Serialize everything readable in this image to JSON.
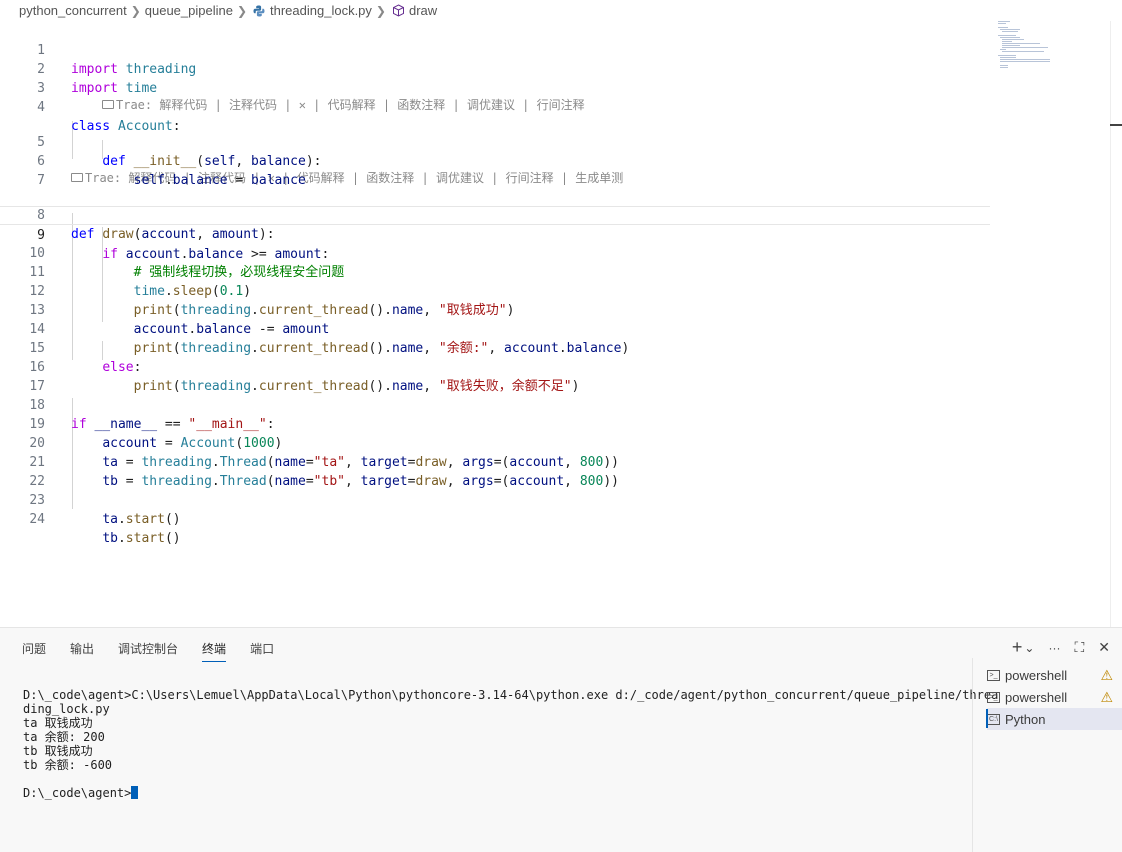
{
  "breadcrumb": {
    "items": [
      "python_concurrent",
      "queue_pipeline",
      "threading_lock.py",
      "draw"
    ]
  },
  "codelens": {
    "class_lens": "Trae: 解释代码 | 注释代码 | ✕ | 代码解释 | 函数注释 | 调优建议 | 行间注释",
    "func_lens": "Trae: 解释代码 | 注释代码 | ✕ | 代码解释 | 函数注释 | 调优建议 | 行间注释 | 生成单测"
  },
  "code": {
    "line_numbers": [
      "1",
      "2",
      "3",
      "4",
      "5",
      "6",
      "7",
      "8",
      "9",
      "10",
      "11",
      "12",
      "13",
      "14",
      "15",
      "16",
      "17",
      "18",
      "19",
      "20",
      "21",
      "22",
      "23",
      "24"
    ],
    "active_line": "9",
    "lines": [
      "import threading",
      "import time",
      "",
      "class Account:",
      "    def __init__(self, balance):",
      "        self.balance = balance",
      "",
      "def draw(account, amount):",
      "    if account.balance >= amount:",
      "        # 强制线程切换，必现线程安全问题",
      "        time.sleep(0.1)",
      "        print(threading.current_thread().name, \"取钱成功\")",
      "        account.balance -= amount",
      "        print(threading.current_thread().name, \"余额:\", account.balance)",
      "    else:",
      "        print(threading.current_thread().name, \"取钱失败，余额不足\")",
      "",
      "if __name__ == \"__main__\":",
      "    account = Account(1000)",
      "    ta = threading.Thread(name=\"ta\", target=draw, args=(account, 800))",
      "    tb = threading.Thread(name=\"tb\", target=draw, args=(account, 800))",
      "",
      "    ta.start()",
      "    tb.start()"
    ]
  },
  "panel": {
    "tabs": [
      "问题",
      "输出",
      "调试控制台",
      "终端",
      "端口"
    ],
    "active_tab": "终端",
    "actions": {
      "add": "+",
      "dropdown": "⌄",
      "more": "···",
      "maximize": "⛶",
      "close": "✕"
    }
  },
  "terminal": {
    "lines": [
      "D:\\_code\\agent>C:\\Users\\Lemuel\\AppData\\Local\\Python\\pythoncore-3.14-64\\python.exe d:/_code/agent/python_concurrent/queue_pipeline/threa",
      "ding_lock.py",
      "ta 取钱成功",
      "ta 余额: 200",
      "tb 取钱成功",
      "tb 余额: -600",
      "",
      "D:\\_code\\agent>"
    ],
    "instances": [
      {
        "name": "powershell",
        "warning": "⚠"
      },
      {
        "name": "powershell",
        "warning": "⚠"
      },
      {
        "name": "Python",
        "warning": ""
      }
    ]
  },
  "colors": {
    "accent": "#005fb8",
    "keyword": "#0000ff",
    "string": "#a31515",
    "comment": "#008000",
    "number": "#098658"
  }
}
